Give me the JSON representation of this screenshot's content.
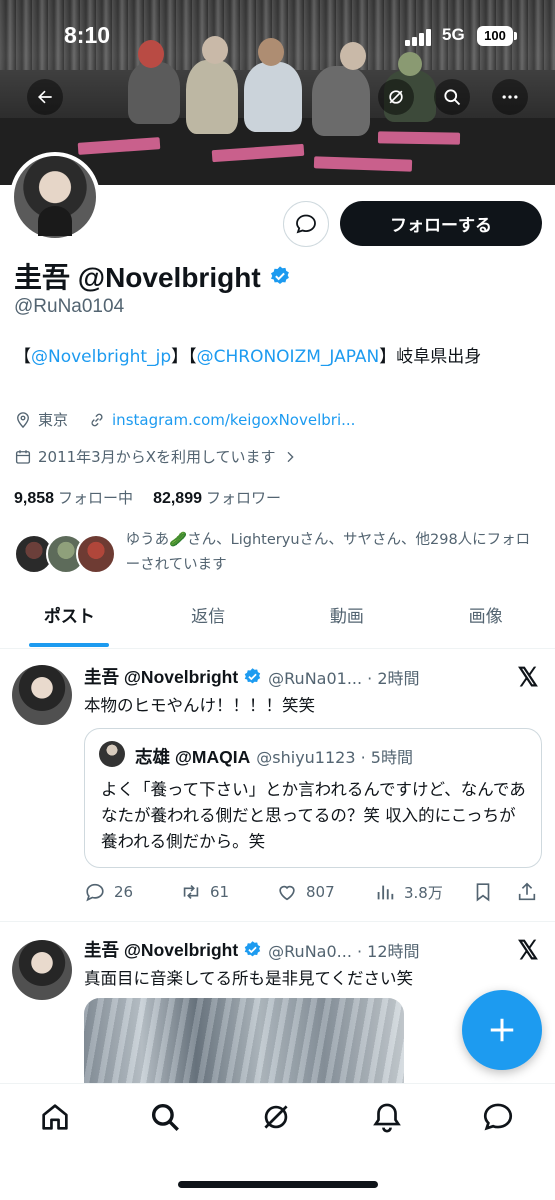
{
  "status_bar": {
    "time": "8:10",
    "network": "5G",
    "battery": "100"
  },
  "profile": {
    "name": "圭吾 @Novelbright",
    "handle": "@RuNa0104",
    "bio_prefix": "【",
    "bio_link1": "@Novelbright_jp",
    "bio_mid": "】【",
    "bio_link2": "@CHRONOIZM_JAPAN",
    "bio_suffix": "】岐阜県出身",
    "location": "東京",
    "website": "instagram.com/keigoxNovelbri...",
    "joined": "2011年3月からXを利用しています",
    "following_count": "9,858",
    "following_label": "フォロー中",
    "followers_count": "82,899",
    "followers_label": "フォロワー",
    "followed_by": "ゆうあ🥒さん、Lighteryuさん、サヤさん、他298人にフォローされています",
    "follow_button": "フォローする"
  },
  "tabs": [
    "ポスト",
    "返信",
    "動画",
    "画像"
  ],
  "posts": [
    {
      "name": "圭吾 @Novelbright",
      "handle_time": "@RuNa01... · 2時間",
      "text": "本物のヒモやんけ！！！！笑笑",
      "quote": {
        "name": "志雄 @MAQIA",
        "handle_time": "@shiyu1123 · 5時間",
        "text": "よく「養って下さい」とか言われるんですけど、なんであなたが養われる側だと思ってるの？笑 収入的にこっちが養われる側だから。笑"
      },
      "replies": "26",
      "reposts": "61",
      "likes": "807",
      "views": "3.8万"
    },
    {
      "name": "圭吾 @Novelbright",
      "handle_time": "@RuNa0... · 12時間",
      "text": "真面目に音楽してる所も是非見てください笑"
    }
  ],
  "colors": {
    "accent": "#1d9bf0",
    "text": "#0f1419",
    "muted": "#536471"
  },
  "icons": [
    "back-arrow-icon",
    "grok-icon",
    "search-icon",
    "more-icon",
    "message-icon",
    "verified-icon",
    "location-icon",
    "link-icon",
    "calendar-icon",
    "x-logo-icon",
    "reply-icon",
    "repost-icon",
    "like-icon",
    "views-icon",
    "bookmark-icon",
    "share-icon",
    "compose-icon",
    "home-icon",
    "notifications-icon"
  ]
}
